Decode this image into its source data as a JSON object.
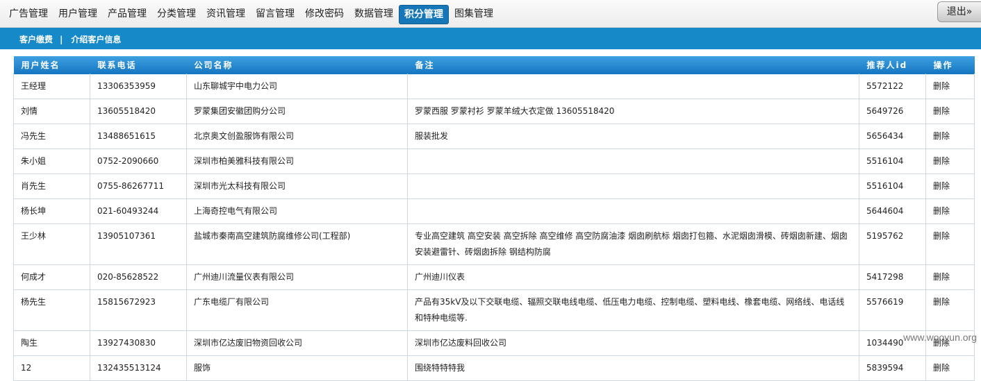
{
  "nav": {
    "items": [
      {
        "label": "广告管理"
      },
      {
        "label": "用户管理"
      },
      {
        "label": "产品管理"
      },
      {
        "label": "分类管理"
      },
      {
        "label": "资讯管理"
      },
      {
        "label": "留言管理"
      },
      {
        "label": "修改密码"
      },
      {
        "label": "数据管理"
      },
      {
        "label": "积分管理",
        "active": true
      },
      {
        "label": "图集管理"
      }
    ],
    "logout_label": "退出»"
  },
  "subnav": {
    "link1": "客户缴费",
    "separator": "|",
    "link2": "介绍客户信息"
  },
  "table": {
    "headers": {
      "name": "用户姓名",
      "phone": "联系电话",
      "company": "公司名称",
      "note": "备注",
      "referrer": "推荐人id",
      "action": "操作"
    },
    "rows": [
      {
        "name": "王经理",
        "phone": "13306353959",
        "company": "山东聊城宇中电力公司",
        "note": "",
        "referrer": "5572122",
        "action": "删除"
      },
      {
        "name": "刘情",
        "phone": "13605518420",
        "company": "罗蒙集团安徽团购分公司",
        "note": "罗蒙西服 罗蒙衬衫 罗蒙羊绒大衣定做 13605518420",
        "referrer": "5649726",
        "action": "删除"
      },
      {
        "name": "冯先生",
        "phone": "13488651615",
        "company": "北京奥文创盈服饰有限公司",
        "note": "服装批发",
        "referrer": "5656434",
        "action": "删除"
      },
      {
        "name": "朱小姐",
        "phone": "0752-2090660",
        "company": "深圳市柏美雅科技有限公司",
        "note": "",
        "referrer": "5516104",
        "action": "删除"
      },
      {
        "name": "肖先生",
        "phone": "0755-86267711",
        "company": "深圳市光太科技有限公司",
        "note": "",
        "referrer": "5516104",
        "action": "删除"
      },
      {
        "name": "杨长坤",
        "phone": "021-60493244",
        "company": "上海奇控电气有限公司",
        "note": "",
        "referrer": "5644604",
        "action": "删除"
      },
      {
        "name": "王少林",
        "phone": "13905107361",
        "company": "盐城市秦南高空建筑防腐维修公司(工程部)",
        "note": "专业高空建筑 高空安装 高空拆除 高空维修 高空防腐油漆 烟囱刷航标 烟囱打包箍、水泥烟囱滑模、砖烟囱新建、烟囱安装避雷针、砖烟囱拆除 钢结构防腐",
        "referrer": "5195762",
        "action": "删除"
      },
      {
        "name": "何成才",
        "phone": "020-85628522",
        "company": "广州迪川流量仪表有限公司",
        "note": "广州迪川仪表",
        "referrer": "5417298",
        "action": "删除"
      },
      {
        "name": "杨先生",
        "phone": "15815672923",
        "company": "广东电缆厂有限公司",
        "note": "产品有35kV及以下交联电缆、辐照交联电线电缆、低压电力电缆、控制电缆、塑料电线、橡套电缆、网络线、电话线和特种电缆等.",
        "referrer": "5576619",
        "action": "删除"
      },
      {
        "name": "陶生",
        "phone": "13927430830",
        "company": "深圳市亿达废旧物资回收公司",
        "note": "深圳市亿达废料回收公司",
        "referrer": "1034490",
        "action": "删除"
      },
      {
        "name": "12",
        "phone": "132435513124",
        "company": "服饰",
        "note": "围绕特特特我",
        "referrer": "5839594",
        "action": "删除"
      }
    ]
  },
  "watermark": "www.wooyun.org"
}
